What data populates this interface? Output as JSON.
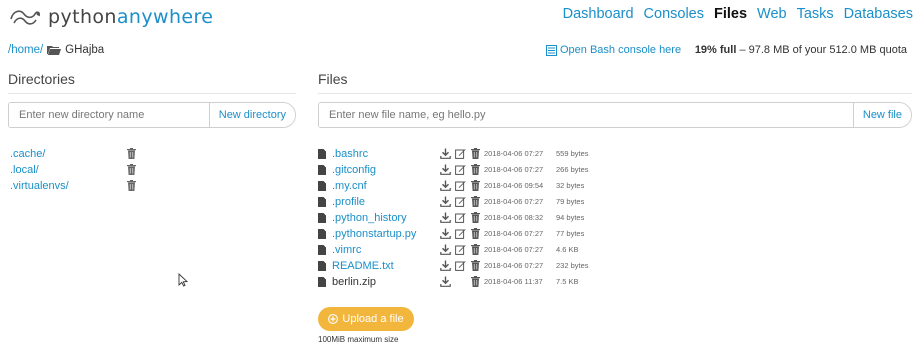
{
  "header": {
    "logo_python": "python",
    "logo_anywhere": "anywhere",
    "nav": [
      {
        "label": "Dashboard",
        "active": false
      },
      {
        "label": "Consoles",
        "active": false
      },
      {
        "label": "Files",
        "active": true
      },
      {
        "label": "Web",
        "active": false
      },
      {
        "label": "Tasks",
        "active": false
      },
      {
        "label": "Databases",
        "active": false
      }
    ]
  },
  "breadcrumb": {
    "home": "/home/",
    "current": "GHajba"
  },
  "bash_link": "Open Bash console here",
  "quota": {
    "percent": "19% full",
    "detail": " – 97.8 MB of your 512.0 MB quota"
  },
  "directories": {
    "title": "Directories",
    "input_placeholder": "Enter new directory name",
    "button": "New directory",
    "items": [
      ".cache/",
      ".local/",
      ".virtualenvs/"
    ]
  },
  "files": {
    "title": "Files",
    "input_placeholder": "Enter new file name, eg hello.py",
    "button": "New file",
    "items": [
      {
        "name": ".bashrc",
        "date": "2018-04-06 07:27",
        "size": "559 bytes",
        "editable": true
      },
      {
        "name": ".gitconfig",
        "date": "2018-04-06 07:27",
        "size": "266 bytes",
        "editable": true
      },
      {
        "name": ".my.cnf",
        "date": "2018-04-06 09:54",
        "size": "32 bytes",
        "editable": true
      },
      {
        "name": ".profile",
        "date": "2018-04-06 07:27",
        "size": "79 bytes",
        "editable": true
      },
      {
        "name": ".python_history",
        "date": "2018-04-06 08:32",
        "size": "94 bytes",
        "editable": true
      },
      {
        "name": ".pythonstartup.py",
        "date": "2018-04-06 07:27",
        "size": "77 bytes",
        "editable": true
      },
      {
        "name": ".vimrc",
        "date": "2018-04-06 07:27",
        "size": "4.6 KB",
        "editable": true
      },
      {
        "name": "README.txt",
        "date": "2018-04-06 07:27",
        "size": "232 bytes",
        "editable": true
      },
      {
        "name": "berlin.zip",
        "date": "2018-04-06 11:37",
        "size": "7.5 KB",
        "editable": false
      }
    ]
  },
  "upload": {
    "button": "Upload a file",
    "note": "100MiB maximum size"
  },
  "colors": {
    "link": "#1a8fc9",
    "upload": "#f2b63c"
  }
}
